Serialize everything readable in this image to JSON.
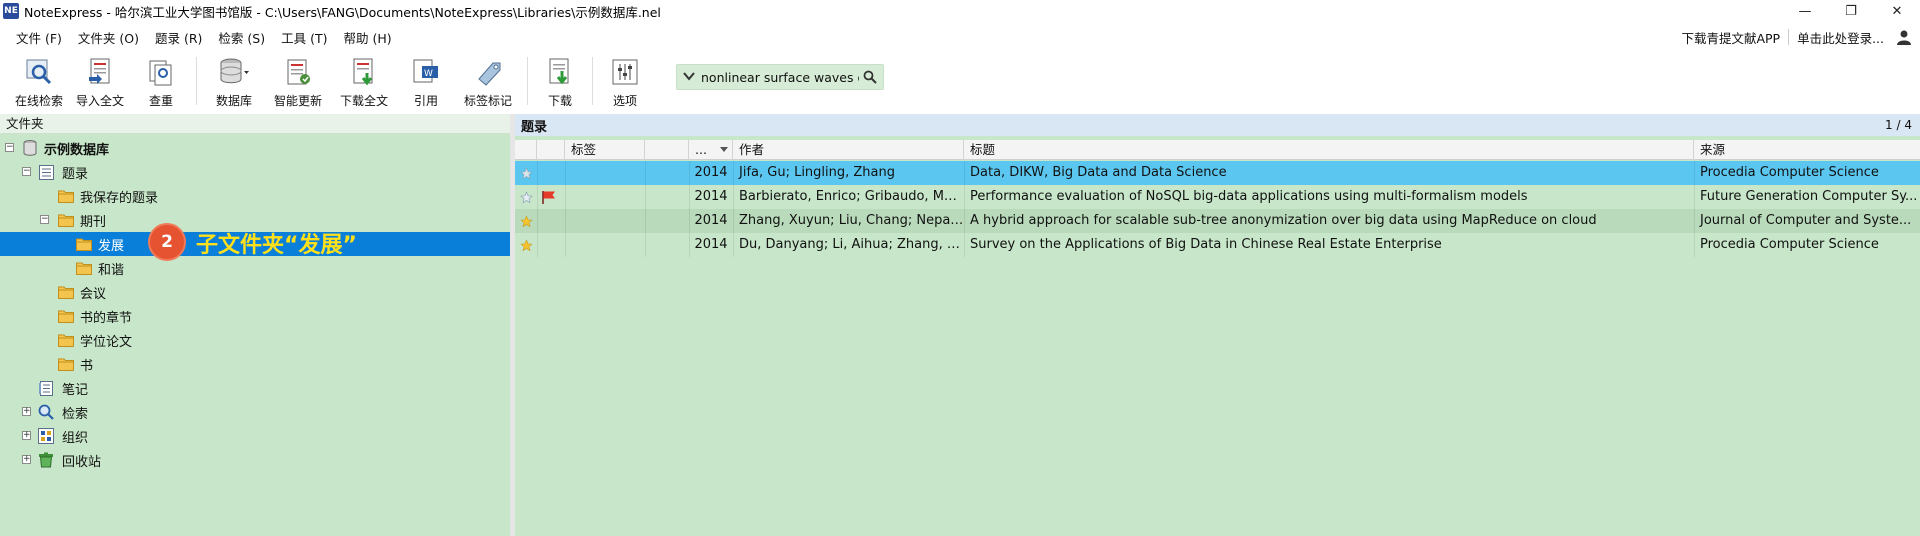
{
  "window": {
    "app_icon": "NE",
    "title": "NoteExpress - 哈尔滨工业大学图书馆版 - C:\\Users\\FANG\\Documents\\NoteExpress\\Libraries\\示例数据库.nel",
    "controls": {
      "minimize": "—",
      "restore": "❐",
      "close": "✕"
    }
  },
  "menu": {
    "items": [
      "文件 (F)",
      "文件夹 (O)",
      "题录 (R)",
      "检索 (S)",
      "工具 (T)",
      "帮助 (H)"
    ],
    "download_app": "下载青提文献APP",
    "login": "单击此处登录..."
  },
  "toolbar": {
    "buttons": [
      {
        "label": "在线检索",
        "icon": "online-search-icon"
      },
      {
        "label": "导入全文",
        "icon": "import-fulltext-icon"
      },
      {
        "label": "查重",
        "icon": "duplicate-check-icon"
      },
      {
        "label": "数据库",
        "icon": "database-icon"
      },
      {
        "label": "智能更新",
        "icon": "smart-update-icon"
      },
      {
        "label": "下载全文",
        "icon": "download-fulltext-icon"
      },
      {
        "label": "引用",
        "icon": "cite-icon"
      },
      {
        "label": "标签标记",
        "icon": "tag-icon"
      },
      {
        "label": "下载",
        "icon": "download-icon"
      },
      {
        "label": "选项",
        "icon": "options-icon"
      }
    ],
    "search_query": "nonlinear surface waves on"
  },
  "left": {
    "header": "文件夹",
    "tree": [
      {
        "label": "示例数据库",
        "level": 0,
        "expander": "−",
        "icon": "database-icon",
        "bold": true
      },
      {
        "label": "题录",
        "level": 1,
        "expander": "−",
        "icon": "references-icon"
      },
      {
        "label": "我保存的题录",
        "level": 2,
        "icon": "folder-icon"
      },
      {
        "label": "期刊",
        "level": 2,
        "expander": "−",
        "icon": "folder-icon"
      },
      {
        "label": "发展",
        "level": 3,
        "icon": "folder-icon",
        "selected": true
      },
      {
        "label": "和谐",
        "level": 3,
        "icon": "folder-icon"
      },
      {
        "label": "会议",
        "level": 2,
        "icon": "folder-icon"
      },
      {
        "label": "书的章节",
        "level": 2,
        "icon": "folder-icon"
      },
      {
        "label": "学位论文",
        "level": 2,
        "icon": "folder-icon"
      },
      {
        "label": "书",
        "level": 2,
        "icon": "folder-icon"
      },
      {
        "label": "笔记",
        "level": 1,
        "icon": "notes-icon"
      },
      {
        "label": "检索",
        "level": 1,
        "expander": "+",
        "icon": "search-icon"
      },
      {
        "label": "组织",
        "level": 1,
        "expander": "+",
        "icon": "organize-icon"
      },
      {
        "label": "回收站",
        "level": 1,
        "expander": "+",
        "icon": "recycle-bin-icon"
      }
    ],
    "annotation": {
      "number": "2",
      "text": "子文件夹“发展”"
    }
  },
  "right": {
    "header": "题录",
    "page": "1 / 4",
    "columns": [
      "",
      "",
      "标签",
      "",
      "...",
      "作者",
      "标题",
      "来源"
    ],
    "rows": [
      {
        "star": "grey",
        "flag": "",
        "year": "2014",
        "author": "Jifa, Gu; Lingling, Zhang",
        "title": "Data, DIKW, Big Data and Data Science",
        "source": "Procedia Computer Science"
      },
      {
        "star": "outline",
        "flag": "red",
        "year": "2014",
        "author": "Barbierato, Enrico; Gribaudo, Mar...",
        "title": "Performance evaluation of NoSQL big-data applications using multi-formalism models",
        "source": "Future Generation Computer Sy..."
      },
      {
        "star": "yellow",
        "flag": "",
        "year": "2014",
        "author": "Zhang, Xuyun; Liu, Chang; Nepal, ...",
        "title": "A hybrid approach for scalable sub-tree anonymization over big data using MapReduce on cloud",
        "source": "Journal of Computer and Syste..."
      },
      {
        "star": "yellow",
        "flag": "",
        "year": "2014",
        "author": "Du, Danyang; Li, Aihua; Zhang, Li...",
        "title": "Survey on the Applications of Big Data in Chinese Real Estate Enterprise",
        "source": "Procedia Computer Science"
      }
    ]
  }
}
